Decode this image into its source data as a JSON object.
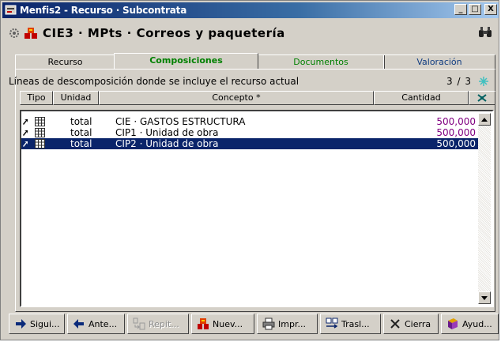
{
  "window": {
    "title": "Menfis2 - Recurso · Subcontrata",
    "controls": {
      "minimize": "_",
      "maximize": "□",
      "close": "X"
    }
  },
  "record": {
    "title": "CIE3 · MPts · Correos y paquetería"
  },
  "tabs": [
    {
      "label": "Recurso"
    },
    {
      "label": "Composiciones"
    },
    {
      "label": "Documentos"
    },
    {
      "label": "Valoración"
    }
  ],
  "panel": {
    "description": "Líneas de descomposición donde se incluye el recurso actual",
    "counter": "3 / 3"
  },
  "grid": {
    "columns": [
      "Tipo",
      "Unidad",
      "Concepto *",
      "Cantidad"
    ],
    "rows": [
      {
        "unit": "total",
        "concept": "CIE · GASTOS ESTRUCTURA",
        "qty": "500,000"
      },
      {
        "unit": "total",
        "concept": "CIP1 · Unidad de obra",
        "qty": "500,000"
      },
      {
        "unit": "total",
        "concept": "CIP2 · Unidad de obra",
        "qty": "500,000"
      }
    ]
  },
  "toolbar": [
    {
      "label": "Sigui..."
    },
    {
      "label": "Ante..."
    },
    {
      "label": "Repit..."
    },
    {
      "label": "Nuev..."
    },
    {
      "label": "Impr..."
    },
    {
      "label": "Trasl..."
    },
    {
      "label": "Cierra"
    },
    {
      "label": "Ayud..."
    }
  ],
  "colors": {
    "selection": "#0a246a",
    "active_tab": "#008000",
    "quantity": "#800080"
  }
}
